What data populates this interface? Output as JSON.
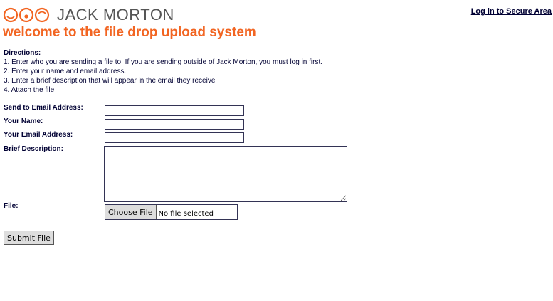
{
  "header": {
    "logo_text": "JACK MORTON",
    "secure_link": "Log in to Secure Area",
    "headline": "welcome to the file drop upload system"
  },
  "directions": {
    "title": "Directions:",
    "steps": [
      "1. Enter who you are sending a file to. If you are sending outside of Jack Morton, you must log in first.",
      "2. Enter your name and email address.",
      "3. Enter a brief description that will appear in the email they receive",
      "4. Attach the file"
    ]
  },
  "form": {
    "send_to_label": "Send to Email Address:",
    "send_to_value": "",
    "your_name_label": "Your Name:",
    "your_name_value": "",
    "your_email_label": "Your Email Address:",
    "your_email_value": "",
    "description_label": "Brief Description:",
    "description_value": "",
    "file_label": "File:",
    "file_button": "Choose File",
    "file_status": "No file selected",
    "submit_label": "Submit File"
  },
  "colors": {
    "accent": "#f26522",
    "text": "#000033",
    "logo_gray": "#555555"
  },
  "icons": {
    "logo": "three-circles-logo-icon"
  }
}
